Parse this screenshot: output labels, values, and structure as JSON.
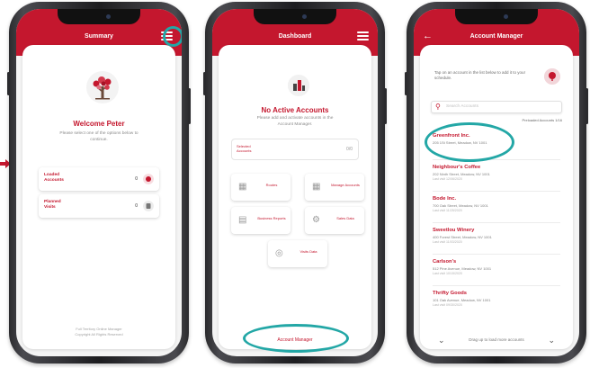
{
  "colors": {
    "brand_red": "#c4172e",
    "highlight_teal": "#23a7a6"
  },
  "phone1": {
    "title": "Summary",
    "menu_icon": "hamburger-menu-icon",
    "welcome": "Welcome Peter",
    "subtitle": "Please select one of the options below to continue.",
    "rows": [
      {
        "label": "Loaded Accounts",
        "count": "0",
        "icon": "star-badge-icon"
      },
      {
        "label": "Planned Visits",
        "count": "0",
        "icon": "person-badge-icon"
      }
    ],
    "footer": "Full Territory Online Manager\nCopyright All Rights Reserved"
  },
  "phone2": {
    "title": "Dashboard",
    "menu_icon": "hamburger-menu-icon",
    "heading": "No Active Accounts",
    "subtitle": "Please add and activate accounts in the Account Manager.",
    "accounts_box_label": "Selected Accounts",
    "accounts_box_value": "0/0",
    "tiles": [
      {
        "label": "Routes",
        "icon": "route-icon"
      },
      {
        "label": "Manage Accounts",
        "icon": "accounts-icon"
      },
      {
        "label": "Business Reports",
        "icon": "reports-icon"
      },
      {
        "label": "Sales Data",
        "icon": "data-icon"
      },
      {
        "label": "Visits Data",
        "icon": "visits-icon"
      }
    ],
    "bottom_button": "Account Manager"
  },
  "phone3": {
    "title": "Account Manager",
    "instruction": "Tap on an account in the list below to add it to your schedule.",
    "search_placeholder": "Search Accounts",
    "preloaded": "Preloaded Accounts 1/16",
    "accounts": [
      {
        "name": "Greenfront Inc.",
        "address": "205 1St Street, Meadow, NV 1001",
        "extra": ""
      },
      {
        "name": "Neighbour's Coffee",
        "address": "202 Ninth Street, Meadow, NV 1001",
        "extra": "Last visit 12/06/2020"
      },
      {
        "name": "Bode Inc.",
        "address": "700 Oak Street, Meadow, NV 1001",
        "extra": "Last visit 11/25/2020"
      },
      {
        "name": "Sweetlou Winery",
        "address": "400 Forest Street, Meadow, NV 1001",
        "extra": "Last visit 11/03/2020"
      },
      {
        "name": "Carlson's",
        "address": "512 Pine Avenue, Meadow, NV 1001",
        "extra": "Last visit 10/15/2020"
      },
      {
        "name": "Thrifty Goods",
        "address": "101 Oak Avenue, Meadow, NV 1001",
        "extra": "Last visit 09/30/2020"
      }
    ],
    "drag_hint": "Drag up to load more accounts"
  }
}
